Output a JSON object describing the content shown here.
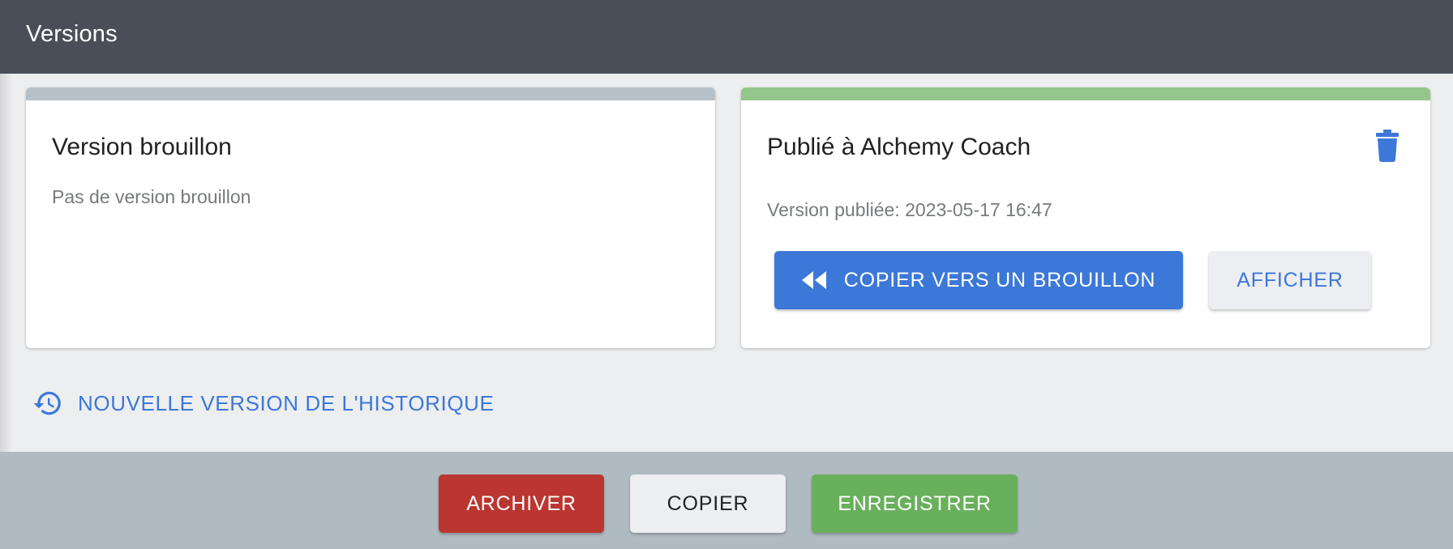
{
  "header": {
    "title": "Versions",
    "background": "#4a4f57"
  },
  "draft_card": {
    "title": "Version brouillon",
    "subtitle": "Pas de version brouillon",
    "accent": "#b5c0c8"
  },
  "published_card": {
    "title": "Publié à Alchemy Coach",
    "subtitle": "Version publiée: 2023-05-17 16:47",
    "accent": "#93c68a",
    "delete_icon": "trash-icon",
    "copy_to_draft_label": "COPIER VERS UN BROUILLON",
    "copy_to_draft_icon": "rewind-icon",
    "show_label": "AFFICHER"
  },
  "history": {
    "label": "NOUVELLE VERSION DE L'HISTORIQUE",
    "icon": "history-icon"
  },
  "footer": {
    "archive_label": "ARCHIVER",
    "copy_label": "COPIER",
    "save_label": "ENREGISTRER"
  },
  "colors": {
    "primary": "#3c78d8",
    "danger": "#bb3630",
    "success": "#69b05c",
    "footer_bg": "#b0bac1"
  }
}
